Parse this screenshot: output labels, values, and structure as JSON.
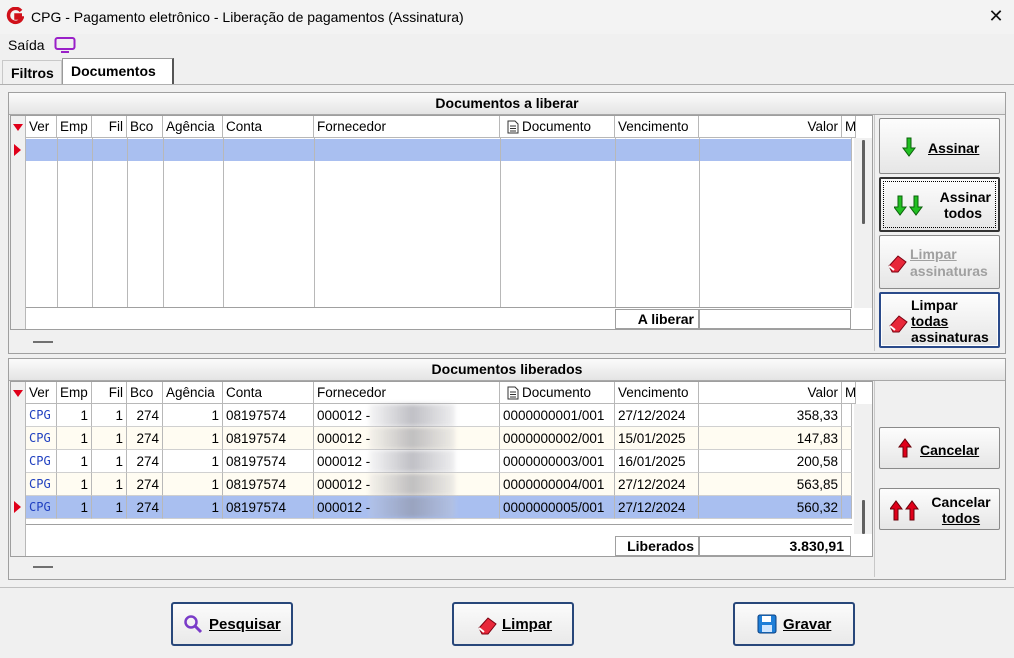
{
  "window": {
    "title": "CPG - Pagamento eletrônico - Liberação de pagamentos (Assinatura)",
    "close_symbol": "✕"
  },
  "menu": {
    "saida_label": "Saída",
    "display_icon": "monitor-icon"
  },
  "tabs": [
    {
      "label": "Filtros"
    },
    {
      "label": "Documentos",
      "active": true
    }
  ],
  "columns": [
    "Ver",
    "Emp",
    "Fil",
    "Bco",
    "Agência",
    "Conta",
    "Fornecedor",
    "Documento",
    "Vencimento",
    "Valor",
    "M"
  ],
  "a_liberar": {
    "title": "Documentos a liberar",
    "footer_label": "A liberar",
    "footer_value": ""
  },
  "liberados": {
    "title": "Documentos liberados",
    "footer_label": "Liberados",
    "footer_value": "3.830,91",
    "rows": [
      {
        "ver": "CPG",
        "emp": "1",
        "fil": "1",
        "bco": "274",
        "agencia": "1",
        "conta": "08197574",
        "fornecedor": "000012 -",
        "documento": "0000000001/001",
        "vencimento": "27/12/2024",
        "valor": "358,33"
      },
      {
        "ver": "CPG",
        "emp": "1",
        "fil": "1",
        "bco": "274",
        "agencia": "1",
        "conta": "08197574",
        "fornecedor": "000012 -",
        "documento": "0000000002/001",
        "vencimento": "15/01/2025",
        "valor": "147,83"
      },
      {
        "ver": "CPG",
        "emp": "1",
        "fil": "1",
        "bco": "274",
        "agencia": "1",
        "conta": "08197574",
        "fornecedor": "000012 -",
        "documento": "0000000003/001",
        "vencimento": "16/01/2025",
        "valor": "200,58"
      },
      {
        "ver": "CPG",
        "emp": "1",
        "fil": "1",
        "bco": "274",
        "agencia": "1",
        "conta": "08197574",
        "fornecedor": "000012 -",
        "documento": "0000000004/001",
        "vencimento": "27/12/2024",
        "valor": "563,85"
      },
      {
        "ver": "CPG",
        "emp": "1",
        "fil": "1",
        "bco": "274",
        "agencia": "1",
        "conta": "08197574",
        "fornecedor": "000012 -",
        "documento": "0000000005/001",
        "vencimento": "27/12/2024",
        "valor": "560,32"
      }
    ]
  },
  "side_buttons": {
    "assinar": "Assinar",
    "assinar_todos_1": "Assinar",
    "assinar_todos_2": "todos",
    "limpar_1": "Limpar",
    "limpar_2": "assinaturas",
    "limpar_todas_1": "Limpar",
    "limpar_todas_2": "todas",
    "limpar_todas_3": "assinaturas",
    "cancelar": "Cancelar",
    "cancelar_todos_1": "Cancelar",
    "cancelar_todos_2": "todos"
  },
  "bottom_buttons": {
    "pesquisar": "Pesquisar",
    "limpar": "Limpar",
    "gravar": "Gravar"
  },
  "colors": {
    "accent": "#2a4a8a",
    "selection": "#a9bff0",
    "row_alt": "#fffcf2",
    "red_arrow": "#e0001a",
    "green_arrow": "#22c022"
  }
}
